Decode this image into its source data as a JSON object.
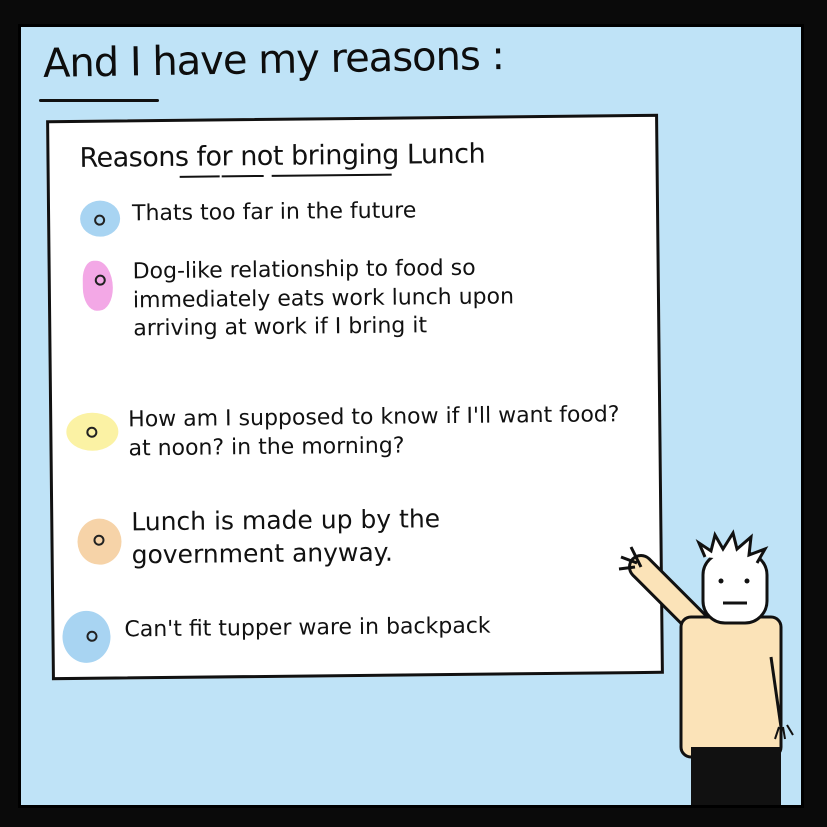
{
  "caption": "And I have my reasons :",
  "board": {
    "title": "Reasons for not bringing Lunch",
    "reasons": [
      {
        "text": "Thats too far in the future",
        "color": "#a8d4f2"
      },
      {
        "text": "Dog-like relationship to food so immediately eats work lunch upon arriving at work if I bring it",
        "color": "#f3a8e6"
      },
      {
        "text": "How am I supposed to know if I'll want food? at noon? in the morning?",
        "color": "#fbf2a4"
      },
      {
        "text": "Lunch is made up by the government anyway.",
        "color": "#f6d3a8"
      },
      {
        "text": "Can't fit tupper ware in backpack",
        "color": "#a8d4f2"
      }
    ]
  },
  "colors": {
    "panel_background": "#bfe3f7",
    "board": "#ffffff",
    "outline": "#111111",
    "shirt": "#fbe3b8"
  }
}
